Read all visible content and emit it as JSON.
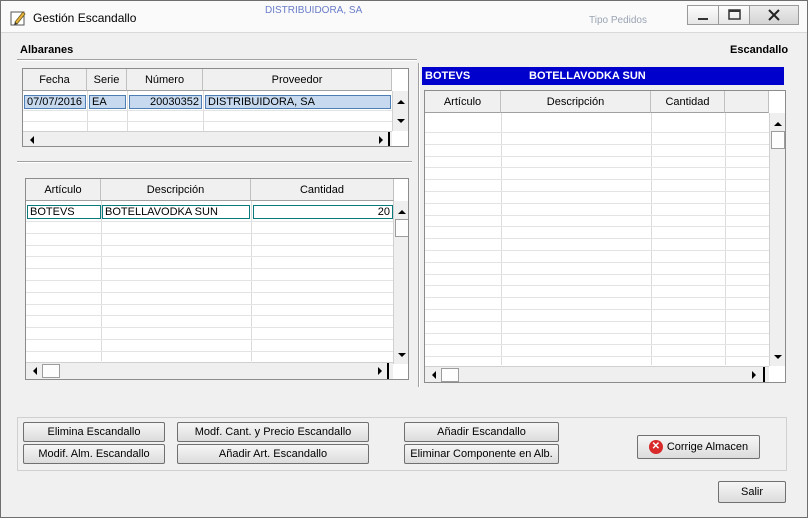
{
  "window": {
    "title": "Gestión Escandallo",
    "bg_ghost_1": "DISTRIBUIDORA, SA",
    "bg_ghost_2": "Tipo Pedidos"
  },
  "sections": {
    "albaranes": "Albaranes",
    "escandallo": "Escandallo"
  },
  "albaranes_grid": {
    "columns": [
      "Fecha",
      "Serie",
      "Número",
      "Proveedor"
    ],
    "rows": [
      {
        "fecha": "07/07/2016",
        "serie": "EA",
        "numero": "20030352",
        "proveedor": "DISTRIBUIDORA, SA"
      }
    ]
  },
  "lines_grid": {
    "columns": [
      "Artículo",
      "Descripción",
      "Cantidad"
    ],
    "rows": [
      {
        "articulo": "BOTEVS",
        "descripcion": "BOTELLAVODKA SUN",
        "cantidad": "20"
      }
    ]
  },
  "escandallo": {
    "article_code": "BOTEVS",
    "article_desc": "BOTELLAVODKA SUN",
    "columns": [
      "Artículo",
      "Descripción",
      "Cantidad"
    ]
  },
  "buttons": {
    "elimina": "Elimina Escandallo",
    "modif_alm": "Modif. Alm. Escandallo",
    "modf_cant": "Modf. Cant. y Precio Escandallo",
    "anadir_art": "Añadir Art. Escandallo",
    "anadir_escandallo": "Añadir Escandallo",
    "eliminar_componente": "Eliminar Componente en Alb.",
    "corrige": "Corrige Almacen",
    "salir": "Salir"
  },
  "colors": {
    "banner": "#0000cc",
    "selection": "#c6d9ef",
    "corrige_icon": "#d82a2a"
  }
}
